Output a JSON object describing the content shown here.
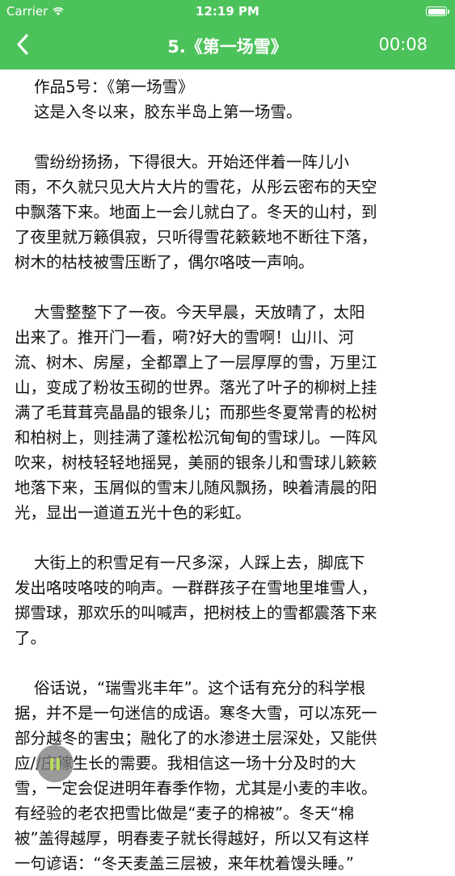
{
  "status_bar": {
    "carrier": "Carrier",
    "time": "12:19 PM"
  },
  "nav": {
    "title": "5.《第一场雪》",
    "timer": "00:08"
  },
  "article": {
    "lines": [
      {
        "text": "作品5号：《第一场雪》",
        "indent": true
      },
      {
        "text": "这是入冬以来，胶东半岛上第一场雪。",
        "indent": true
      },
      {
        "text": "",
        "gap": true
      },
      {
        "text": "雪纷纷扬扬，下得很大。开始还伴着一阵儿小",
        "indent": true
      },
      {
        "text": "雨，不久就只见大片大片的雪花，从彤云密布的天空"
      },
      {
        "text": "中飘落下来。地面上一会儿就白了。冬天的山村，到"
      },
      {
        "text": "了夜里就万籁俱寂，只听得雪花簌簌地不断往下落，"
      },
      {
        "text": "树木的枯枝被雪压断了，偶尔咯吱一声响。"
      },
      {
        "text": "",
        "gap": true
      },
      {
        "text": "大雪整整下了一夜。今天早晨，天放晴了，太阳",
        "indent": true
      },
      {
        "text": "出来了。推开门一看，嗬?好大的雪啊！山川、河"
      },
      {
        "text": "流、树木、房屋，全都罩上了一层厚厚的雪，万里江"
      },
      {
        "text": "山，变成了粉妆玉砌的世界。落光了叶子的柳树上挂"
      },
      {
        "text": "满了毛茸茸亮晶晶的银条儿；而那些冬夏常青的松树"
      },
      {
        "text": "和柏树上，则挂满了蓬松松沉甸甸的雪球儿。一阵风"
      },
      {
        "text": "吹来，树枝轻轻地摇晃，美丽的银条儿和雪球儿簌簌"
      },
      {
        "text": "地落下来，玉屑似的雪末儿随风飘扬，映着清晨的阳"
      },
      {
        "text": "光，显出一道道五光十色的彩虹。"
      },
      {
        "text": "",
        "gap": true
      },
      {
        "text": "大街上的积雪足有一尺多深，人踩上去，脚底下",
        "indent": true
      },
      {
        "text": "发出咯吱咯吱的响声。一群群孩子在雪地里堆雪人，"
      },
      {
        "text": "掷雪球，那欢乐的叫喊声，把树枝上的雪都震落下来"
      },
      {
        "text": "了。"
      },
      {
        "text": "",
        "gap": true
      },
      {
        "text": "俗话说，“瑞雪兆丰年”。这个话有充分的科学根",
        "indent": true
      },
      {
        "text": "据，并不是一句迷信的成语。寒冬大雪，可以冻死一"
      },
      {
        "text": "部分越冬的害虫；融化了的水渗进土层深处，又能供"
      },
      {
        "text": "应//庄稼生长的需要。我相信这一场十分及时的大"
      },
      {
        "text": "雪，一定会促进明年春季作物，尤其是小麦的丰收。"
      },
      {
        "text": "有经验的老农把雪比做是“麦子的棉被”。冬天“棉"
      },
      {
        "text": "被”盖得越厚，明春麦子就长得越好，所以又有这样"
      },
      {
        "text": "一句谚语：“冬天麦盖三层被，来年枕着馒头睡。”"
      }
    ]
  },
  "colors": {
    "accent": "#4cc25a",
    "pause_bar": "#b8e05a"
  },
  "icons": {
    "back": "chevron-left-icon",
    "pause": "pause-icon",
    "wifi": "wifi-icon",
    "battery": "battery-icon"
  }
}
